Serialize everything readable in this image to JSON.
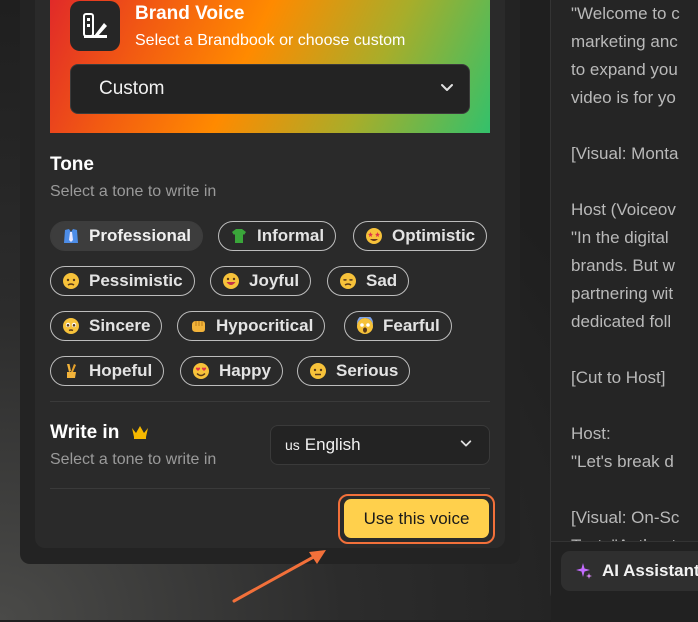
{
  "brand": {
    "title": "Brand Voice",
    "subtitle": "Select a Brandbook or choose custom",
    "selected": "Custom"
  },
  "tone": {
    "title": "Tone",
    "subtitle": "Select a tone to write in",
    "chips": [
      {
        "label": "Professional",
        "icon": "necktie-shirt-icon",
        "active": true
      },
      {
        "label": "Informal",
        "icon": "t-shirt-icon",
        "active": false
      },
      {
        "label": "Optimistic",
        "icon": "star-struck-face-icon",
        "active": false
      },
      {
        "label": "Pessimistic",
        "icon": "worried-face-icon",
        "active": false
      },
      {
        "label": "Joyful",
        "icon": "grinning-face-icon",
        "active": false
      },
      {
        "label": "Sad",
        "icon": "sad-face-icon",
        "active": false
      },
      {
        "label": "Sincere",
        "icon": "pleading-face-icon",
        "active": false
      },
      {
        "label": "Hypocritical",
        "icon": "punch-hand-icon",
        "active": false
      },
      {
        "label": "Fearful",
        "icon": "screaming-face-icon",
        "active": false
      },
      {
        "label": "Hopeful",
        "icon": "crossed-fingers-icon",
        "active": false
      },
      {
        "label": "Happy",
        "icon": "heart-eyes-face-icon",
        "active": false
      },
      {
        "label": "Serious",
        "icon": "neutral-face-icon",
        "active": false
      }
    ]
  },
  "write_in": {
    "title": "Write in",
    "subtitle": "Select a tone to write in",
    "language_flag": "us",
    "language": "English"
  },
  "action": {
    "use_voice_label": "Use this voice"
  },
  "script": {
    "lines": [
      "\"Welcome to c",
      "marketing anc",
      "to expand you",
      "video is for yo",
      "",
      "[Visual: Monta",
      "",
      "Host (Voiceov",
      "\"In the digital",
      "brands. But w",
      "partnering wit",
      "dedicated foll",
      "",
      "[Cut to Host]",
      "",
      "Host:",
      "\"Let's break d",
      "",
      "[Visual: On-Sc",
      "Text: \"Authent"
    ]
  },
  "assistant": {
    "label": "AI Assistant"
  },
  "colors": {
    "accent_button": "#ffd04c",
    "highlight_ring": "#f2703a",
    "crown": "#f5b800",
    "sparkle": "#c46bff"
  }
}
